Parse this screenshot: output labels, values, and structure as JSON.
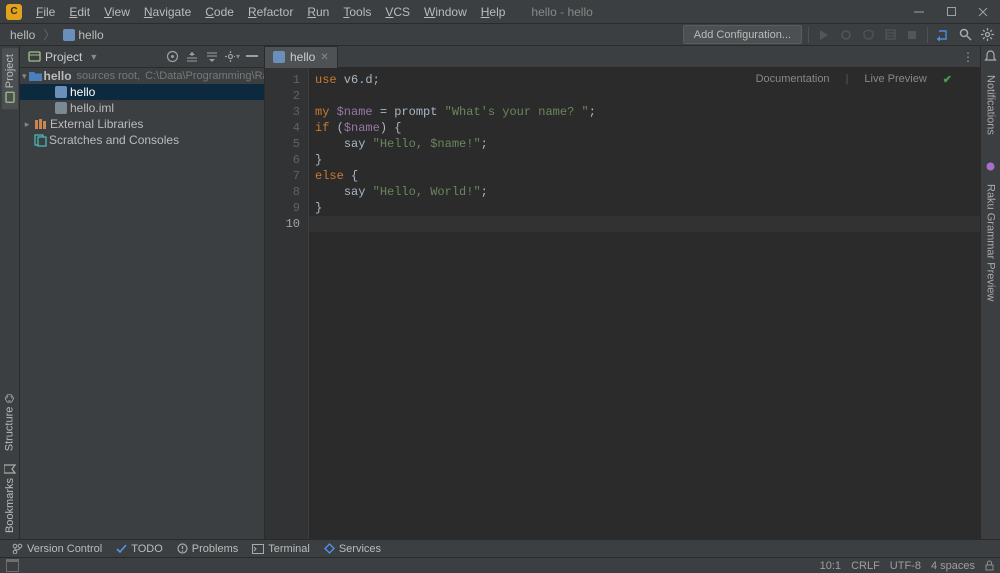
{
  "window_title": "hello - hello",
  "menu": {
    "items": [
      "File",
      "Edit",
      "View",
      "Navigate",
      "Code",
      "Refactor",
      "Run",
      "Tools",
      "VCS",
      "Window",
      "Help"
    ]
  },
  "breadcrumb": {
    "root": "hello",
    "file": "hello"
  },
  "navbar": {
    "add_config": "Add Configuration..."
  },
  "project_panel": {
    "label": "Project",
    "root": {
      "name": "hello",
      "sub1": "sources root,",
      "sub2": "C:\\Data\\Programming\\Raku\\hello"
    },
    "files": [
      "hello",
      "hello.iml"
    ],
    "externals": "External Libraries",
    "scratches": "Scratches and Consoles"
  },
  "editor": {
    "tab_name": "hello",
    "code_lines": [
      {
        "n": 1,
        "segs": [
          {
            "t": "use",
            "c": "kw"
          },
          {
            "t": " v6.d;",
            "c": ""
          }
        ]
      },
      {
        "n": 2,
        "segs": []
      },
      {
        "n": 3,
        "segs": [
          {
            "t": "my",
            "c": "kw"
          },
          {
            "t": " ",
            "c": ""
          },
          {
            "t": "$name",
            "c": "var"
          },
          {
            "t": " = ",
            "c": ""
          },
          {
            "t": "prompt",
            "c": ""
          },
          {
            "t": " ",
            "c": ""
          },
          {
            "t": "\"What's your name? \"",
            "c": "str"
          },
          {
            "t": ";",
            "c": ""
          }
        ]
      },
      {
        "n": 4,
        "segs": [
          {
            "t": "if",
            "c": "kw"
          },
          {
            "t": " (",
            "c": ""
          },
          {
            "t": "$name",
            "c": "var"
          },
          {
            "t": ") {",
            "c": ""
          }
        ]
      },
      {
        "n": 5,
        "segs": [
          {
            "t": "    ",
            "c": ""
          },
          {
            "t": "say",
            "c": ""
          },
          {
            "t": " ",
            "c": ""
          },
          {
            "t": "\"Hello, ",
            "c": "str"
          },
          {
            "t": "$name",
            "c": "str"
          },
          {
            "t": "!\"",
            "c": "str"
          },
          {
            "t": ";",
            "c": ""
          }
        ]
      },
      {
        "n": 6,
        "segs": [
          {
            "t": "}",
            "c": ""
          }
        ]
      },
      {
        "n": 7,
        "segs": [
          {
            "t": "else",
            "c": "kw"
          },
          {
            "t": " {",
            "c": ""
          }
        ]
      },
      {
        "n": 8,
        "segs": [
          {
            "t": "    ",
            "c": ""
          },
          {
            "t": "say",
            "c": ""
          },
          {
            "t": " ",
            "c": ""
          },
          {
            "t": "\"Hello, World!\"",
            "c": "str"
          },
          {
            "t": ";",
            "c": ""
          }
        ]
      },
      {
        "n": 9,
        "segs": [
          {
            "t": "}",
            "c": ""
          }
        ]
      },
      {
        "n": 10,
        "segs": []
      }
    ],
    "current_line": 10,
    "overlay": {
      "doc": "Documentation",
      "preview": "Live Preview"
    }
  },
  "left_tabs": {
    "project": "Project",
    "structure": "Structure",
    "bookmarks": "Bookmarks"
  },
  "right_tabs": {
    "notifications": "Notifications",
    "grammar": "Raku Grammar Preview"
  },
  "bottom": {
    "vcs": "Version Control",
    "todo": "TODO",
    "problems": "Problems",
    "terminal": "Terminal",
    "services": "Services"
  },
  "status": {
    "pos": "10:1",
    "eol": "CRLF",
    "enc": "UTF-8",
    "indent": "4 spaces"
  }
}
